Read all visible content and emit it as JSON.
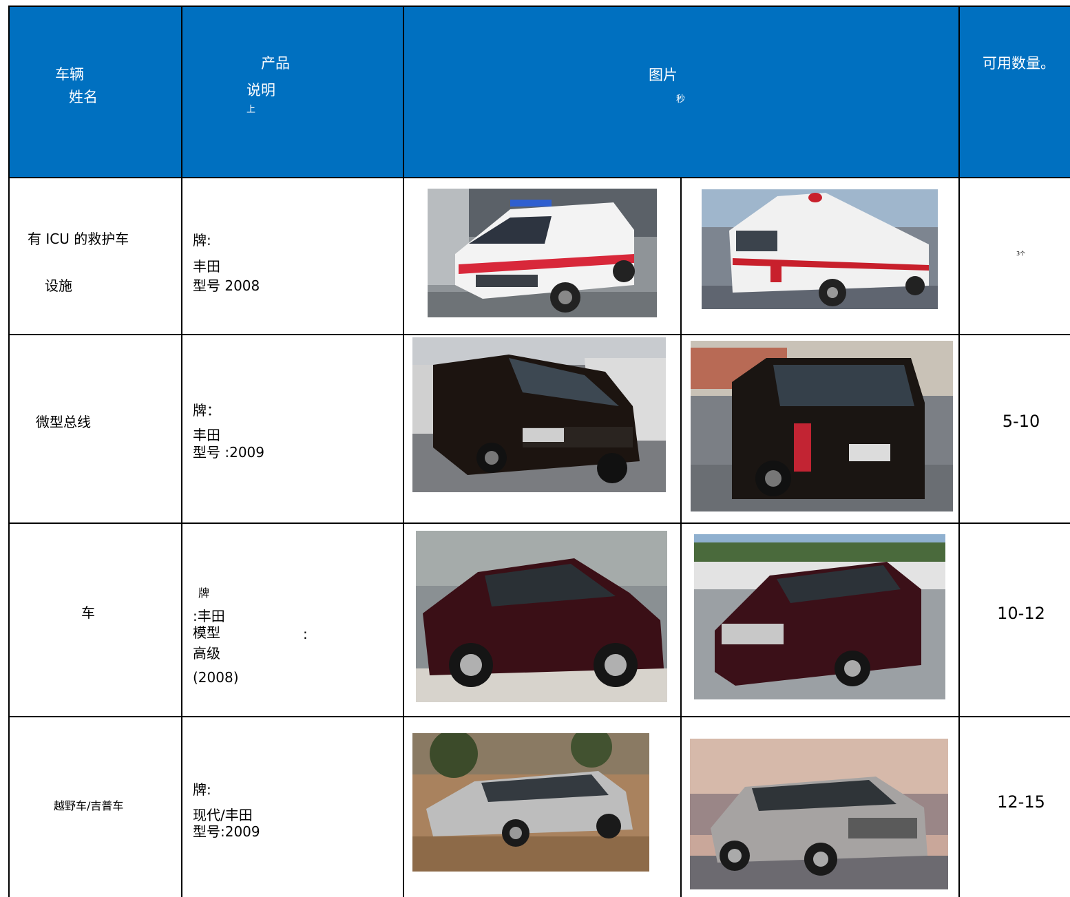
{
  "header": {
    "col_vehicle": [
      "车辆",
      "姓名"
    ],
    "col_product": [
      "产品",
      "说明",
      "上"
    ],
    "col_picture": [
      "图片",
      "秒"
    ],
    "col_qty": "可用数量。"
  },
  "rows": [
    {
      "name": [
        "有 ICU 的救护车",
        "设施"
      ],
      "desc": [
        "牌:",
        "丰田",
        "型号 2008"
      ],
      "qty": "3个",
      "photos": [
        "ambulance-front-photo",
        "ambulance-rear-photo"
      ]
    },
    {
      "name": [
        "微型总线"
      ],
      "desc": [
        "牌：",
        "丰田",
        "型号 :2009"
      ],
      "qty": "5-10",
      "photos": [
        "minibus-front-photo",
        "minibus-rear-photo"
      ]
    },
    {
      "name": [
        "车"
      ],
      "desc": [
        "牌",
        ":丰田",
        "模型",
        ":",
        "高级",
        "(2008)"
      ],
      "qty": "10-12",
      "photos": [
        "sedan-side-photo",
        "sedan-front-photo"
      ]
    },
    {
      "name": [
        "越野车/吉普车"
      ],
      "desc": [
        "牌:",
        "现代/丰田",
        "型号:2009"
      ],
      "qty": "12-15",
      "photos": [
        "suv-desert-photo",
        "suv-sunset-photo"
      ]
    }
  ],
  "colors": {
    "header_bg": "#0070c0",
    "header_text": "#ffffff",
    "grid": "#000000"
  }
}
